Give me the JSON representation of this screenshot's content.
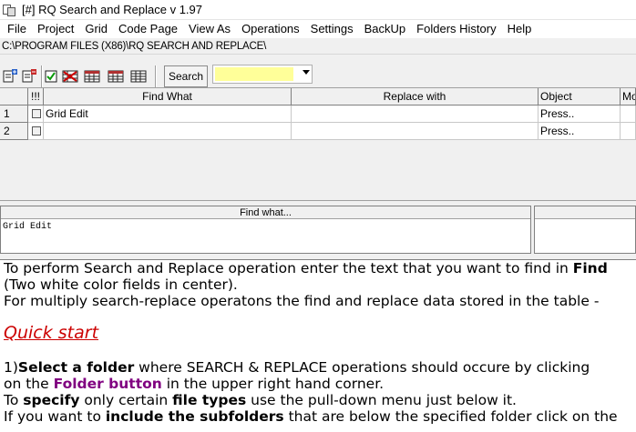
{
  "window": {
    "title": "[#] RQ Search and Replace v 1.97"
  },
  "menu": [
    "File",
    "Project",
    "Grid",
    "Code Page",
    "View As",
    "Operations",
    "Settings",
    "BackUp",
    "Folders History",
    "Help"
  ],
  "path": "C:\\PROGRAM FILES (X86)\\RQ SEARCH AND REPLACE\\",
  "toolbar": {
    "search_label": "Search",
    "combo_value": "",
    "combo_color": "#ffff99"
  },
  "grid": {
    "headers": {
      "num": "",
      "flag": "!!!",
      "find": "Find What",
      "replace": "Replace with",
      "object": "Object",
      "mode": "Mo"
    },
    "rows": [
      {
        "num": "1",
        "find": "Grid Edit",
        "replace": "",
        "object": "Press.."
      },
      {
        "num": "2",
        "find": "",
        "replace": "",
        "object": "Press.."
      }
    ]
  },
  "find_panel": {
    "header": "Find what...",
    "text": "Grid Edit"
  },
  "help": {
    "line1_a": "To perform Search and Replace operation enter the text that you want to find in ",
    "line1_b": "Find",
    "line2": "(Two white color fields in center).",
    "line3": "For multiply search-replace operatons the find and replace data stored in the table -",
    "quick_start": "Quick start",
    "s1_num": "1)",
    "s1_bold": "Select a folder",
    "s1_rest": " where SEARCH & REPLACE operations should occure by clicking",
    "s2_a": "on the ",
    "s2_link": "Folder button",
    "s2_b": " in the upper right hand corner.",
    "s3_a": "To ",
    "s3_bold1": "specify",
    "s3_b": " only certain ",
    "s3_bold2": "file types",
    "s3_c": " use the pull-down menu just below it.",
    "s4_a": "If you want to ",
    "s4_bold": "include the subfolders",
    "s4_b": " that are below the specified folder click on the"
  },
  "colors": {
    "purple_link": "#800080",
    "quick_start": "#cc0000"
  }
}
